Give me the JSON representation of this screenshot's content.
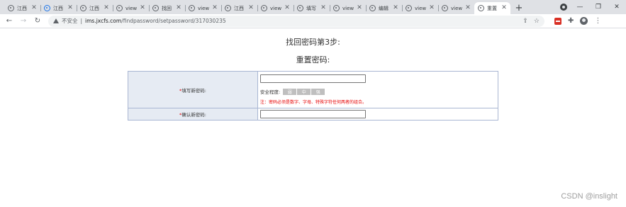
{
  "tabs": [
    {
      "title": "江西",
      "icon": "globe-icon",
      "active": false
    },
    {
      "title": "江西",
      "icon": "globe-icon-blue",
      "active": false
    },
    {
      "title": "江西",
      "icon": "globe-icon",
      "active": false
    },
    {
      "title": "view",
      "icon": "globe-icon",
      "active": false
    },
    {
      "title": "找回",
      "icon": "globe-icon",
      "active": false
    },
    {
      "title": "view",
      "icon": "globe-icon",
      "active": false
    },
    {
      "title": "江西",
      "icon": "globe-icon",
      "active": false
    },
    {
      "title": "view",
      "icon": "globe-icon",
      "active": false
    },
    {
      "title": "填写",
      "icon": "globe-icon",
      "active": false
    },
    {
      "title": "view",
      "icon": "globe-icon",
      "active": false
    },
    {
      "title": "编辑",
      "icon": "globe-icon",
      "active": false
    },
    {
      "title": "view",
      "icon": "globe-icon",
      "active": false
    },
    {
      "title": "view",
      "icon": "globe-icon",
      "active": false
    },
    {
      "title": "重置",
      "icon": "globe-icon",
      "active": true
    }
  ],
  "address_bar": {
    "security": "不安全",
    "separator": "|",
    "host": "ims.jxcfs.com",
    "path": "/findpassword/setpassword/317030235"
  },
  "page": {
    "step_title": "找回密码第3步:",
    "sub_title": "重置密码:",
    "new_password": {
      "required_mark": "*",
      "label": "填写新密码:",
      "value": "",
      "strength_label": "安全程度:",
      "strength_levels": [
        "弱",
        "中",
        "强"
      ],
      "hint": "注：密码必须是数字、字母、特殊字符任何两者的组合。"
    },
    "confirm_password": {
      "required_mark": "*",
      "label": "确认新密码:",
      "value": ""
    }
  },
  "watermark": "CSDN @inslight",
  "colors": {
    "label_bg": "#e6ebf3",
    "table_border": "#a9b6d3",
    "required": "#e60000",
    "strength_bar": "#bfbfbf"
  }
}
